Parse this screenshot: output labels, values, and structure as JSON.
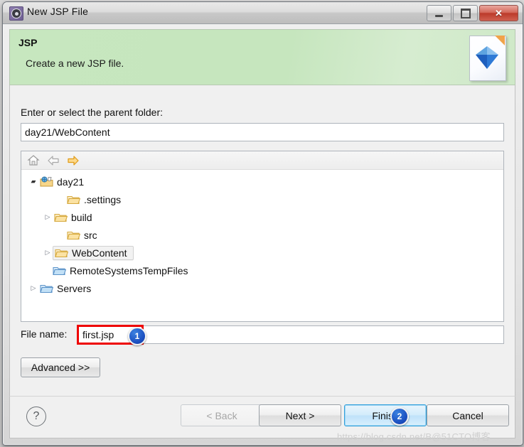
{
  "window": {
    "title": "New JSP File",
    "icon": "gear-icon",
    "minimize_label": "Minimize",
    "maximize_label": "Maximize",
    "close_label": "Close",
    "close_glyph": "✕"
  },
  "banner": {
    "title": "JSP",
    "subtitle": "Create a new JSP file.",
    "icon": "jsp-file-icon",
    "bg_color": "#c7e7bf"
  },
  "form": {
    "parent_folder_label": "Enter or select the parent folder:",
    "parent_folder_value": "day21/WebContent",
    "parent_folder_placeholder": "",
    "file_name_label": "File name:",
    "file_name_value": "first.jsp",
    "file_name_placeholder": "",
    "advanced_label": "Advanced >>"
  },
  "tree_toolbar": {
    "home": "home-icon",
    "back": "back-arrow-icon",
    "forward": "forward-arrow-icon"
  },
  "tree": {
    "items": [
      {
        "label": "day21",
        "icon": "project-icon",
        "indent": 0,
        "twisty": "expanded",
        "selected": false
      },
      {
        "label": ".settings",
        "icon": "folder-icon",
        "indent": 2,
        "twisty": "none",
        "selected": false
      },
      {
        "label": "build",
        "icon": "folder-icon",
        "indent": 2,
        "twisty": "collapsed",
        "selected": false
      },
      {
        "label": "src",
        "icon": "folder-icon",
        "indent": 2,
        "twisty": "none",
        "selected": false
      },
      {
        "label": "WebContent",
        "icon": "folder-icon",
        "indent": 2,
        "twisty": "collapsed",
        "selected": true
      },
      {
        "label": "RemoteSystemsTempFiles",
        "icon": "blue-folder-icon",
        "indent": 1,
        "twisty": "none",
        "selected": false
      },
      {
        "label": "Servers",
        "icon": "blue-folder-icon",
        "indent": 0,
        "twisty": "collapsed",
        "selected": false
      }
    ]
  },
  "footer": {
    "help_label": "?",
    "back_label": "< Back",
    "next_label": "Next >",
    "finish_label": "Finish",
    "cancel_label": "Cancel"
  },
  "annotations": {
    "badge1": "1",
    "badge2": "2",
    "highlight_color": "#ee0000",
    "badge_color": "#1b4fc0"
  },
  "watermark": "https://blog.csdn.net/B@51CTO博客"
}
